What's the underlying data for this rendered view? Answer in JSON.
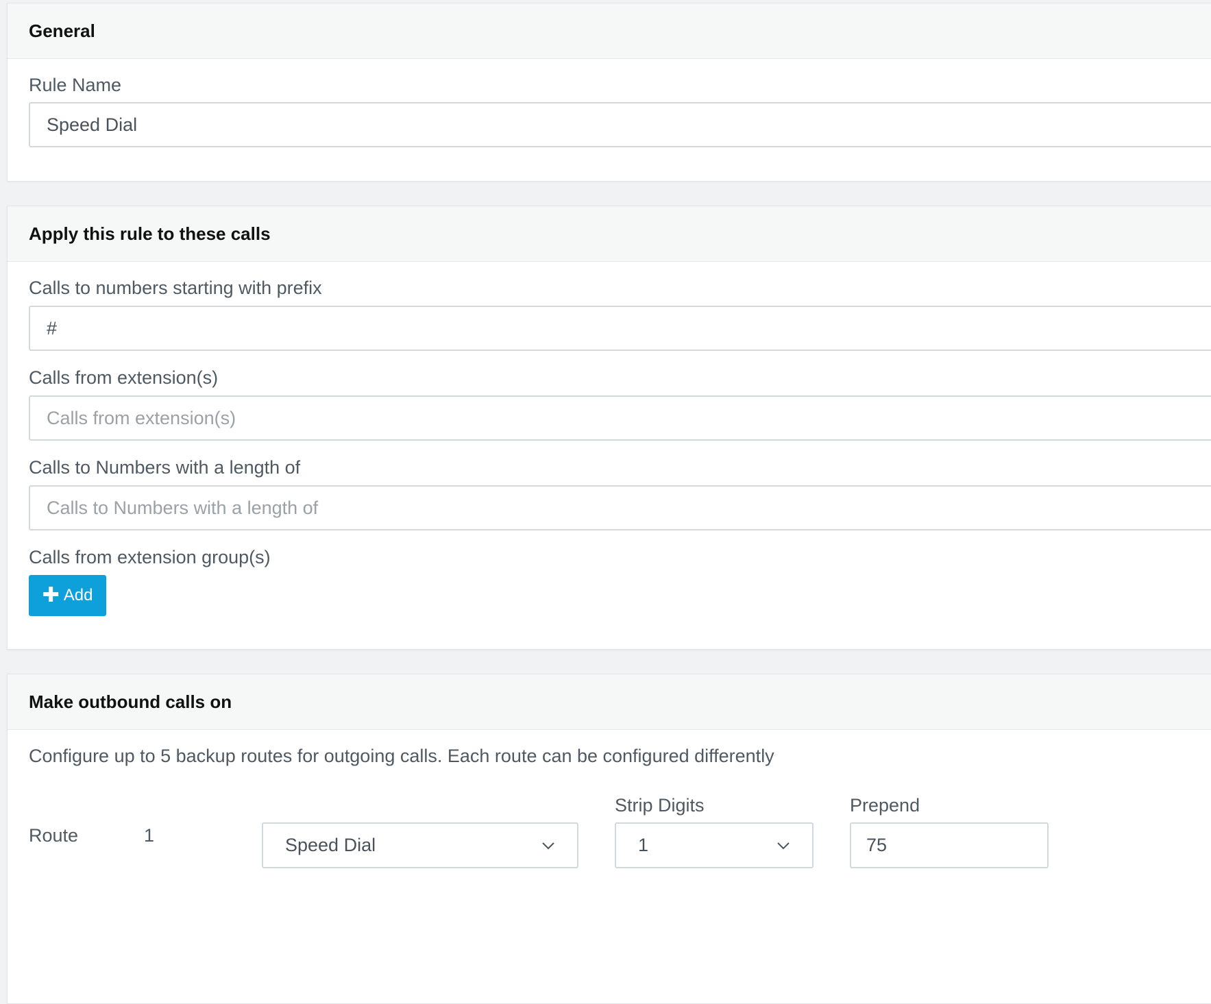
{
  "general": {
    "title": "General",
    "rule_name_label": "Rule Name",
    "rule_name_value": "Speed Dial"
  },
  "apply": {
    "title": "Apply this rule to these calls",
    "prefix_label": "Calls to numbers starting with prefix",
    "prefix_value": "#",
    "from_ext_label": "Calls from extension(s)",
    "from_ext_placeholder": "Calls from extension(s)",
    "length_label": "Calls to Numbers with a length of",
    "length_placeholder": "Calls to Numbers with a length of",
    "group_label": "Calls from extension group(s)",
    "add_label": "Add"
  },
  "outbound": {
    "title": "Make outbound calls on",
    "description": "Configure up to 5 backup routes for outgoing calls. Each route can be configured differently",
    "strip_label": "Strip Digits",
    "prepend_label": "Prepend",
    "route_label": "Route",
    "route_number": "1",
    "route_value": "Speed Dial",
    "strip_value": "1",
    "prepend_value": "75"
  }
}
